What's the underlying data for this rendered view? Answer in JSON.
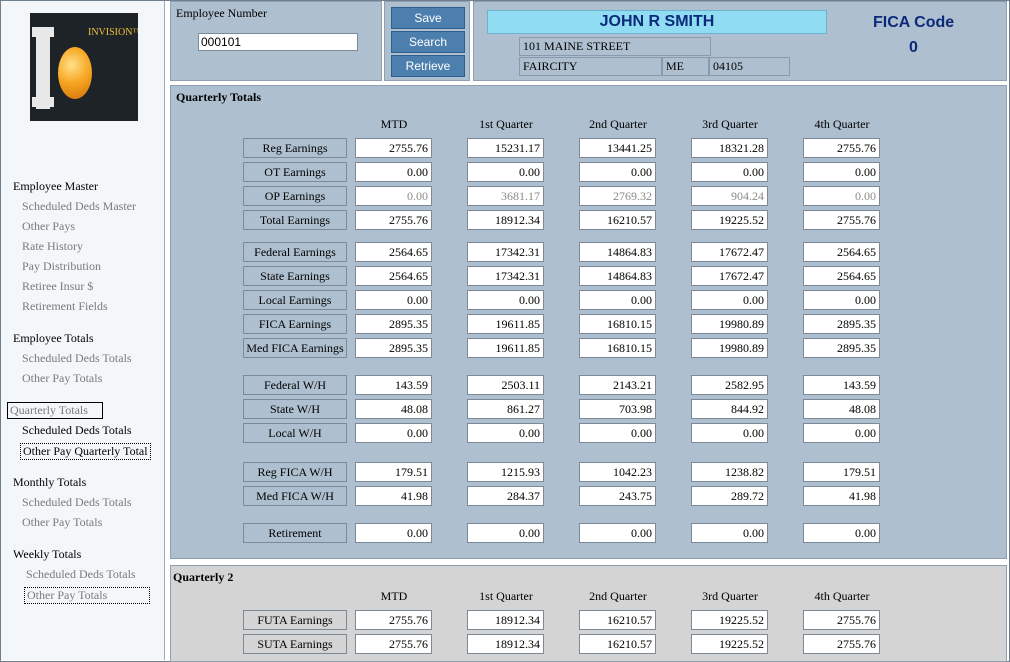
{
  "sidebar": {
    "logo_text": "INVISION™",
    "sections": [
      {
        "label": "Employee Master",
        "items": [
          "Scheduled Deds Master",
          "Other Pays",
          "Rate History",
          "Pay Distribution",
          "Retiree Insur $",
          "Retirement Fields"
        ]
      },
      {
        "label": "Employee Totals",
        "items": [
          "Scheduled Deds Totals",
          "Other Pay Totals"
        ]
      },
      {
        "label": "Quarterly Totals",
        "items": [
          "Scheduled Deds Totals",
          "Other Pay Quarterly Total"
        ]
      },
      {
        "label": "Monthly Totals",
        "items": [
          "Scheduled Deds Totals",
          "Other Pay Totals"
        ]
      },
      {
        "label": "Weekly Totals",
        "items": [
          "Scheduled Deds Totals",
          "Other Pay Totals"
        ]
      }
    ]
  },
  "header": {
    "employee_number_label": "Employee Number",
    "employee_number_value": "000101",
    "buttons": {
      "save": "Save",
      "search": "Search",
      "retrieve": "Retrieve"
    },
    "name": "JOHN R SMITH",
    "street": "101 MAINE STREET",
    "city": "FAIRCITY",
    "state": "ME",
    "zip": "04105",
    "fica_code_label": "FICA Code",
    "fica_code_value": "0"
  },
  "quarterly": {
    "title": "Quarterly Totals",
    "columns": [
      "MTD",
      "1st Quarter",
      "2nd Quarter",
      "3rd Quarter",
      "4th Quarter"
    ],
    "rows": [
      {
        "label": "Reg Earnings",
        "values": [
          "2755.76",
          "15231.17",
          "13441.25",
          "18321.28",
          "2755.76"
        ]
      },
      {
        "label": "OT Earnings",
        "values": [
          "0.00",
          "0.00",
          "0.00",
          "0.00",
          "0.00"
        ]
      },
      {
        "label": "OP Earnings",
        "values": [
          "0.00",
          "3681.17",
          "2769.32",
          "904.24",
          "0.00"
        ]
      },
      {
        "label": "Total Earnings",
        "values": [
          "2755.76",
          "18912.34",
          "16210.57",
          "19225.52",
          "2755.76"
        ]
      },
      {
        "label": "Federal Earnings",
        "values": [
          "2564.65",
          "17342.31",
          "14864.83",
          "17672.47",
          "2564.65"
        ]
      },
      {
        "label": "State Earnings",
        "values": [
          "2564.65",
          "17342.31",
          "14864.83",
          "17672.47",
          "2564.65"
        ]
      },
      {
        "label": "Local Earnings",
        "values": [
          "0.00",
          "0.00",
          "0.00",
          "0.00",
          "0.00"
        ]
      },
      {
        "label": "FICA Earnings",
        "values": [
          "2895.35",
          "19611.85",
          "16810.15",
          "19980.89",
          "2895.35"
        ]
      },
      {
        "label": "Med FICA Earnings",
        "values": [
          "2895.35",
          "19611.85",
          "16810.15",
          "19980.89",
          "2895.35"
        ]
      },
      {
        "label": "Federal W/H",
        "values": [
          "143.59",
          "2503.11",
          "2143.21",
          "2582.95",
          "143.59"
        ]
      },
      {
        "label": "State W/H",
        "values": [
          "48.08",
          "861.27",
          "703.98",
          "844.92",
          "48.08"
        ]
      },
      {
        "label": "Local W/H",
        "values": [
          "0.00",
          "0.00",
          "0.00",
          "0.00",
          "0.00"
        ]
      },
      {
        "label": "Reg FICA W/H",
        "values": [
          "179.51",
          "1215.93",
          "1042.23",
          "1238.82",
          "179.51"
        ]
      },
      {
        "label": "Med FICA W/H",
        "values": [
          "41.98",
          "284.37",
          "243.75",
          "289.72",
          "41.98"
        ]
      },
      {
        "label": "Retirement",
        "values": [
          "0.00",
          "0.00",
          "0.00",
          "0.00",
          "0.00"
        ]
      }
    ]
  },
  "quarterly2": {
    "title": "Quarterly 2",
    "columns": [
      "MTD",
      "1st Quarter",
      "2nd Quarter",
      "3rd Quarter",
      "4th Quarter"
    ],
    "rows": [
      {
        "label": "FUTA Earnings",
        "values": [
          "2755.76",
          "18912.34",
          "16210.57",
          "19225.52",
          "2755.76"
        ]
      },
      {
        "label": "SUTA Earnings",
        "values": [
          "2755.76",
          "18912.34",
          "16210.57",
          "19225.52",
          "2755.76"
        ]
      }
    ]
  }
}
